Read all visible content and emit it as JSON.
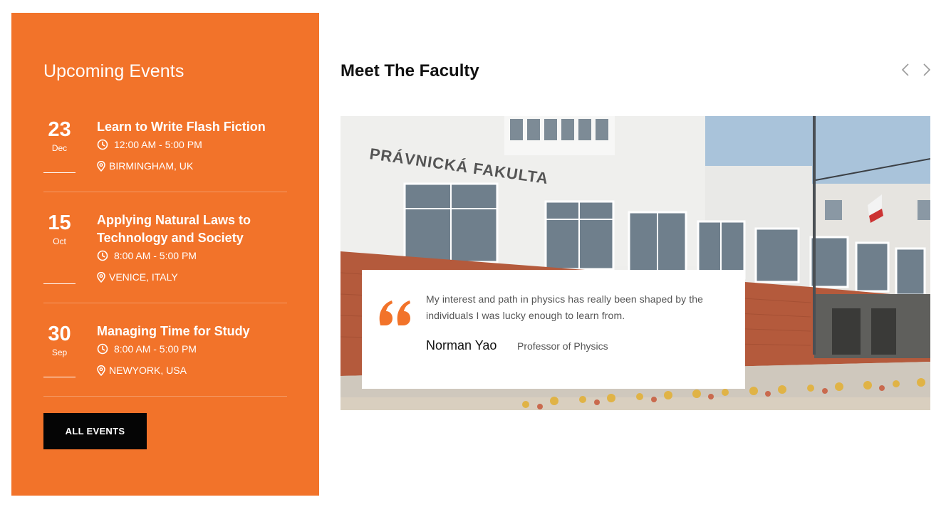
{
  "events_panel": {
    "title": "Upcoming Events",
    "events": [
      {
        "day": "23",
        "month": "Dec",
        "title": "Learn to Write Flash Fiction",
        "time": "12:00 AM - 5:00 PM",
        "location": "BIRMINGHAM, UK"
      },
      {
        "day": "15",
        "month": "Oct",
        "title": "Applying Natural Laws to Technology and Society",
        "time": "8:00 AM - 5:00 PM",
        "location": "VENICE, ITALY"
      },
      {
        "day": "30",
        "month": "Sep",
        "title": "Managing Time for Study",
        "time": "8:00 AM - 5:00 PM",
        "location": "NEWYORK, USA"
      }
    ],
    "button_label": "ALL EVENTS"
  },
  "faculty": {
    "title": "Meet The Faculty",
    "photo_sign": "PRÁVNICKÁ FAKULTA",
    "quote": "My interest and path in physics has really been shaped by the individuals I was lucky enough to learn from.",
    "name": "Norman Yao",
    "role": "Professor of Physics"
  },
  "icons": {
    "time": "clock-icon",
    "location": "map-pin-icon",
    "quote": "quote-icon",
    "prev": "chevron-left-icon",
    "next": "chevron-right-icon"
  },
  "colors": {
    "accent": "#f2732a",
    "button": "#050505"
  }
}
